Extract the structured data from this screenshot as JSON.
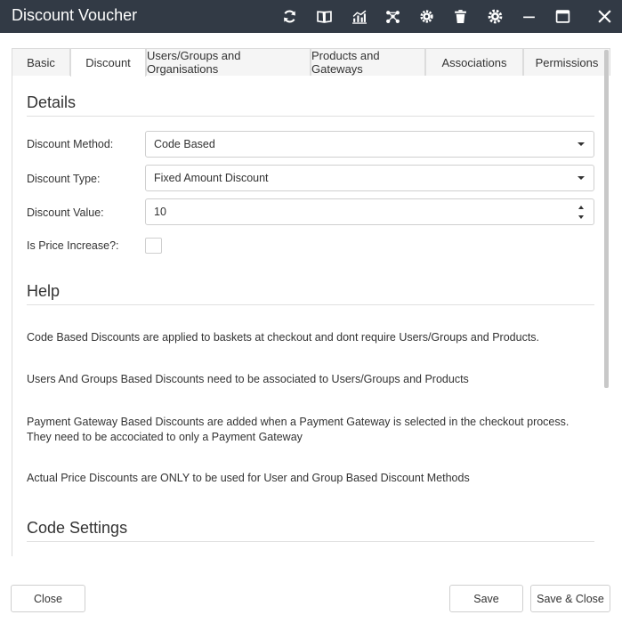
{
  "window": {
    "title": "Discount Voucher",
    "toolbar_icons": [
      "refresh-icon",
      "book-icon",
      "chart-icon",
      "network-icon",
      "settings-cog-icon",
      "trash-icon",
      "gear-icon",
      "minimize-icon",
      "maximize-icon",
      "close-icon"
    ]
  },
  "tabs": [
    {
      "label": "Basic"
    },
    {
      "label": "Discount"
    },
    {
      "label": "Users/Groups and Organisations"
    },
    {
      "label": "Products and Gateways"
    },
    {
      "label": "Associations"
    },
    {
      "label": "Permissions"
    }
  ],
  "active_tab": "Discount",
  "details": {
    "title": "Details",
    "discount_method_label": "Discount Method:",
    "discount_method_value": "Code Based",
    "discount_type_label": "Discount Type:",
    "discount_type_value": "Fixed Amount Discount",
    "discount_value_label": "Discount Value:",
    "discount_value_value": "10",
    "price_increase_label": "Is Price Increase?:",
    "price_increase_checked": false
  },
  "help": {
    "title": "Help",
    "lines": [
      "Code Based Discounts are applied to baskets at checkout and dont require Users/Groups and Products.",
      "Users And Groups Based Discounts need to be associated to Users/Groups and Products",
      "Payment Gateway Based Discounts are added when a Payment Gateway is selected in the checkout process. They need to be accociated to only a Payment Gateway",
      "Actual Price Discounts are ONLY to be used for User and Group Based Discount Methods"
    ]
  },
  "code_settings": {
    "title": "Code Settings"
  },
  "footer": {
    "close_label": "Close",
    "save_label": "Save",
    "save_close_label": "Save & Close"
  }
}
